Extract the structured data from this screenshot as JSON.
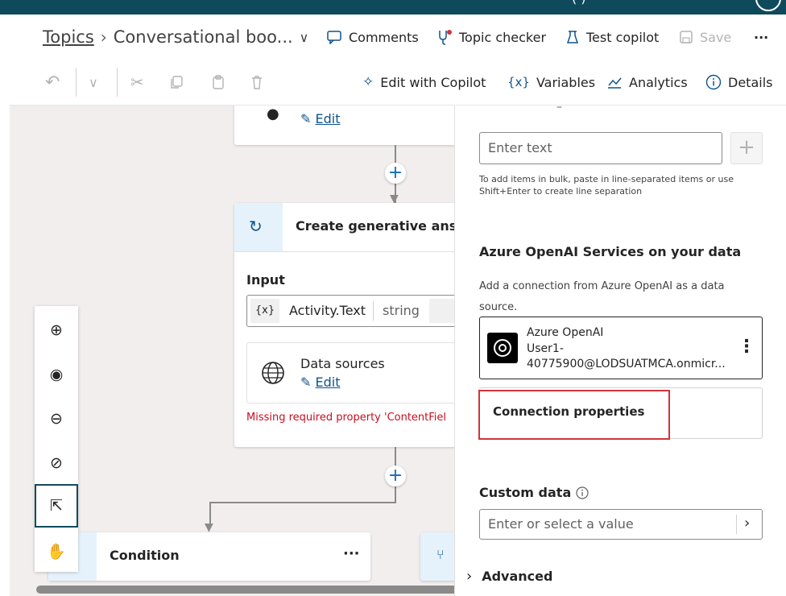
{
  "header": {
    "breadcrumb_root": "Topics",
    "topic_name": "Conversational boo...",
    "comments": "Comments",
    "topic_checker": "Topic checker",
    "test_copilot": "Test copilot",
    "save": "Save",
    "more": "···"
  },
  "toolbar": {
    "edit_with_copilot": "Edit with Copilot",
    "variables": "Variables",
    "analytics": "Analytics",
    "details": "Details"
  },
  "canvas": {
    "top_card_edit": "Edit",
    "gen_title": "Create generative answer",
    "input_label": "Input",
    "var_prefix": "{x}",
    "var_name": "Activity.Text",
    "var_type": "string",
    "data_sources_title": "Data sources",
    "data_sources_edit": "Edit",
    "error_text": "Missing required property 'ContentFiel",
    "condition_title": "Condition",
    "condition_more": "···",
    "plus": "+"
  },
  "panel": {
    "text_placeholder": "Enter text",
    "bulk_hint": "To add items in bulk, paste in line-separated items or use Shift+Enter to create line separation",
    "azure_heading": "Azure OpenAI Services on your data",
    "azure_desc": "Add a connection from Azure OpenAI as a data source.",
    "conn_name": "Azure OpenAI",
    "conn_user_line1": "User1-",
    "conn_user_line2": "40775900@LODSUATMCA.onmicr...",
    "conn_more": "⋮",
    "conn_props": "Connection properties",
    "custom_data_label": "Custom data",
    "custom_data_placeholder": "Enter or select a value",
    "advanced": "Advanced"
  },
  "colors": {
    "accent": "#0f6cbd",
    "highlight_border": "#d13438",
    "error": "#c50f1f",
    "topbar": "#0f4a5c"
  }
}
